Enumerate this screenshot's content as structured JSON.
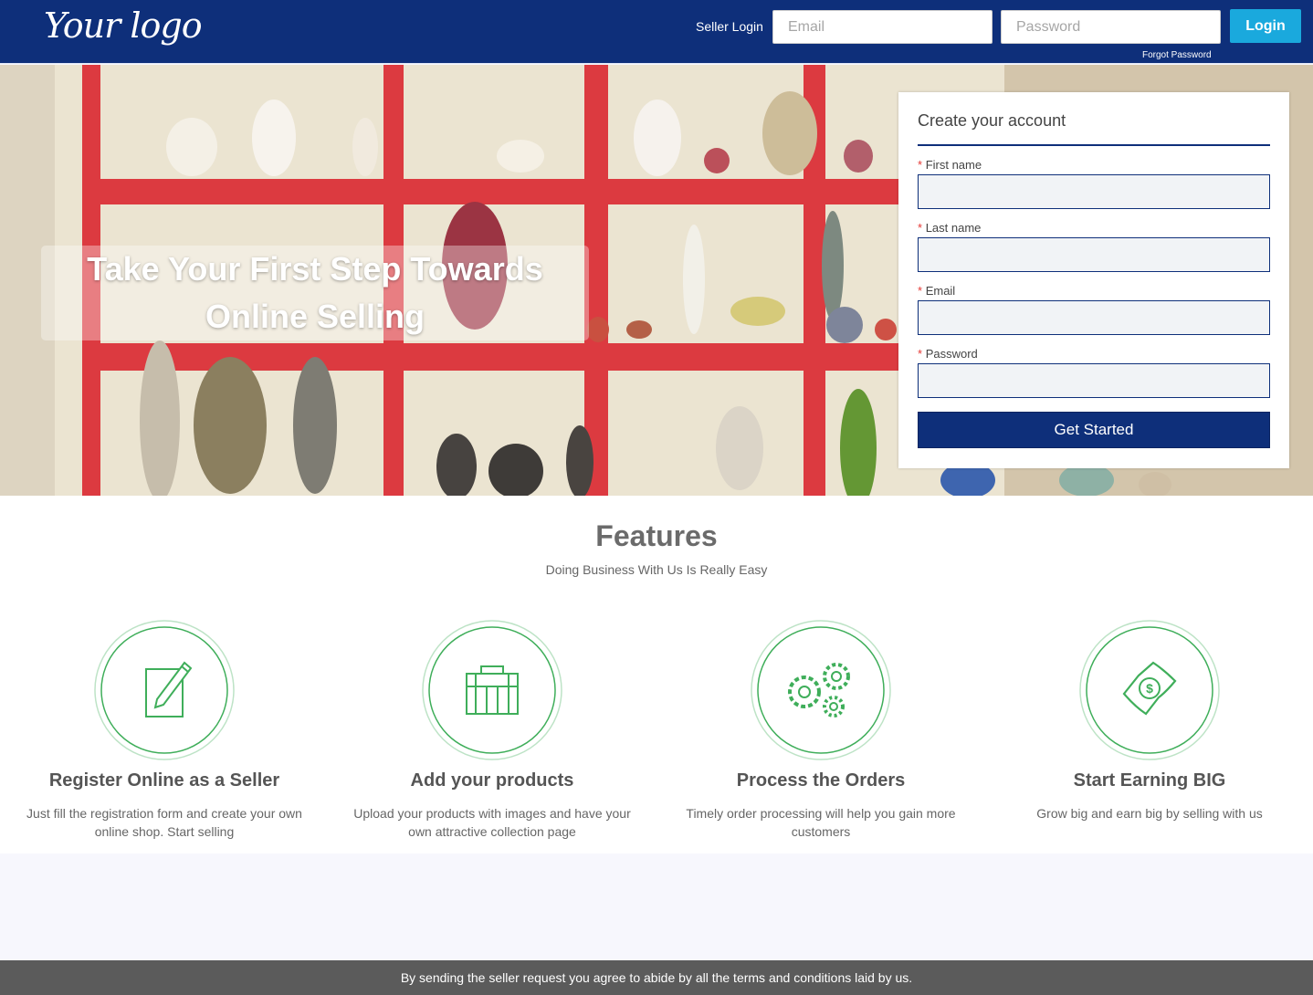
{
  "header": {
    "logo_text": "Your logo",
    "seller_login_label": "Seller Login",
    "email_placeholder": "Email",
    "password_placeholder": "Password",
    "login_button": "Login",
    "forgot_password": "Forgot Password"
  },
  "hero": {
    "line1": "Take Your First Step Towards",
    "line2": "Online Selling"
  },
  "signup_form": {
    "title": "Create your account",
    "required_mark": "*",
    "fields": [
      {
        "label": "First name"
      },
      {
        "label": "Last name"
      },
      {
        "label": "Email"
      },
      {
        "label": "Password"
      }
    ],
    "submit": "Get Started"
  },
  "features": {
    "title": "Features",
    "subtitle": "Doing Business With Us Is Really Easy",
    "items": [
      {
        "icon": "edit-icon",
        "name": "Register Online as a Seller",
        "desc": "Just fill the registration form and create your own online shop. Start selling"
      },
      {
        "icon": "briefcase-icon",
        "name": "Add your products",
        "desc": "Upload your products with images and have your own attractive collection page"
      },
      {
        "icon": "gears-icon",
        "name": "Process the Orders",
        "desc": "Timely order processing will help you gain more customers"
      },
      {
        "icon": "money-icon",
        "name": "Start Earning BIG",
        "desc": "Grow big and earn big by selling with us"
      }
    ]
  },
  "footer": {
    "text": "By sending the seller request you agree to abide by all the terms and conditions laid by us."
  },
  "colors": {
    "brand_blue": "#0e2f7a",
    "login_button": "#1aa9dd",
    "icon_green": "#3fae5a",
    "footer_gray": "#5b5b5b"
  }
}
